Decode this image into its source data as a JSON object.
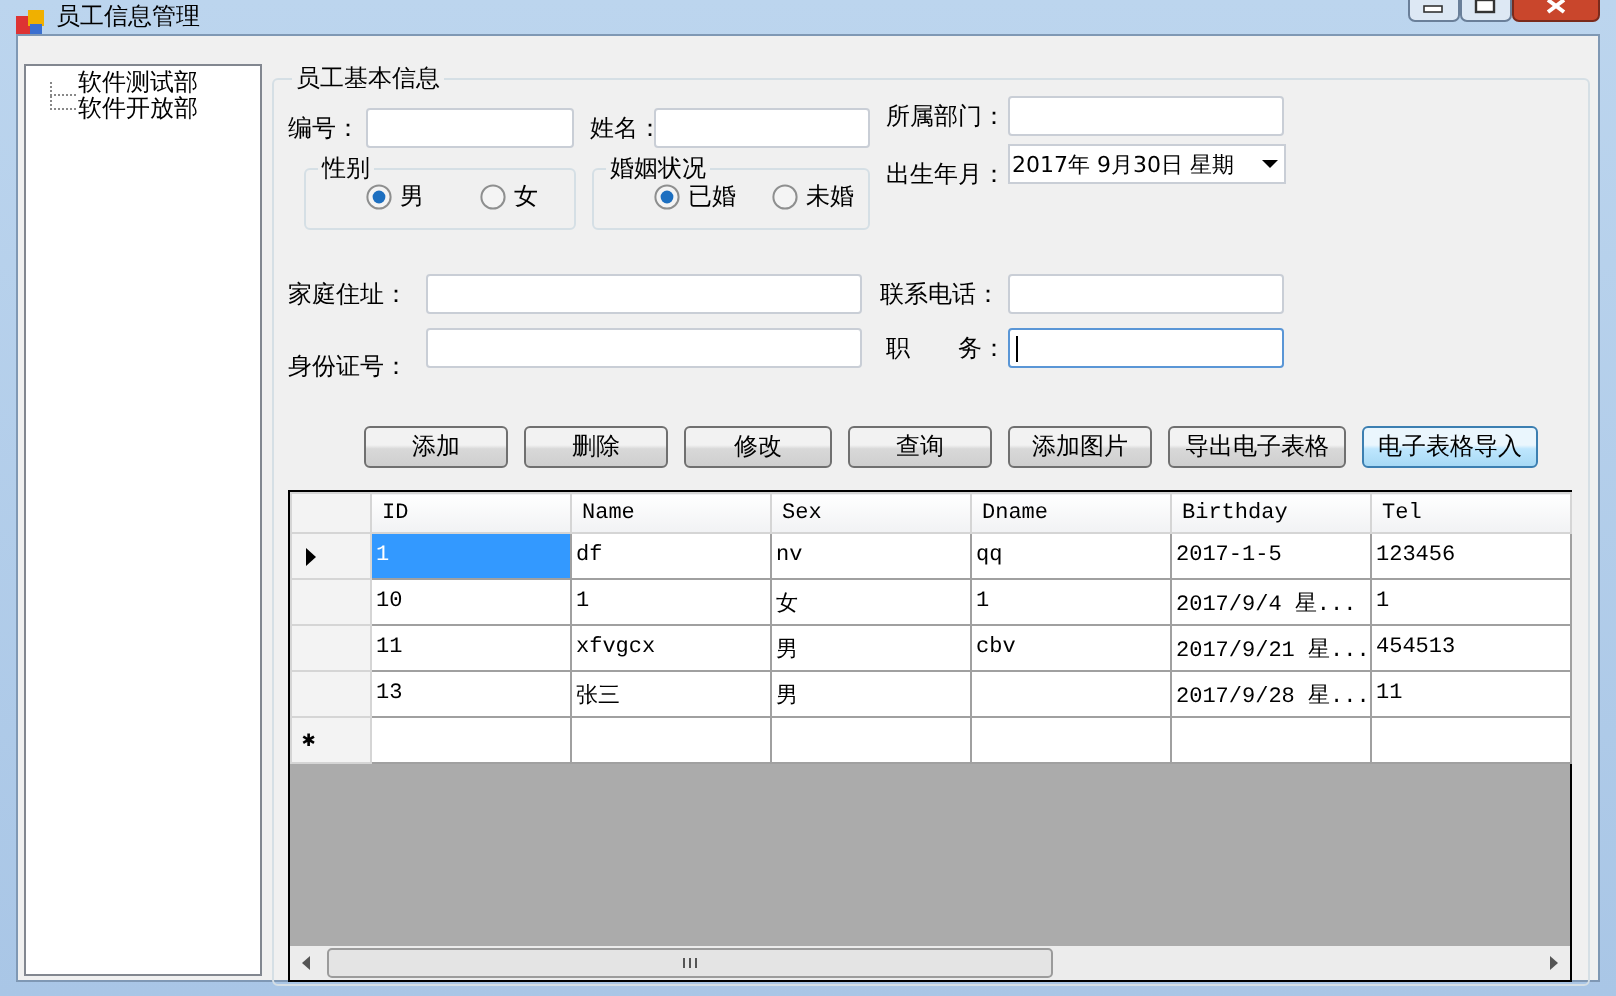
{
  "window": {
    "title": "员工信息管理"
  },
  "tree": {
    "items": [
      {
        "label": "软件测试部",
        "selected": false
      },
      {
        "label": "软件开放部",
        "selected": false
      }
    ]
  },
  "form": {
    "title": "员工基本信息",
    "fields": [
      {
        "label": "编号：",
        "focused": false
      },
      {
        "label": "姓名：",
        "focused": false
      },
      {
        "label": "所属部门：",
        "focused": false
      },
      {
        "label": "家庭住址：",
        "focused": false
      },
      {
        "label": "联系电话：",
        "focused": false
      },
      {
        "label": "身份证号：",
        "focused": false
      },
      {
        "label": "职　　务：",
        "focused": true
      }
    ],
    "radio_groups": [
      {
        "title": "性别",
        "options": [
          {
            "label": "男",
            "selected": true
          },
          {
            "label": "女",
            "selected": false
          }
        ]
      },
      {
        "title": "婚姻状况",
        "options": [
          {
            "label": "已婚",
            "selected": true
          },
          {
            "label": "未婚",
            "selected": false
          }
        ]
      }
    ],
    "date": {
      "label": "出生年月：",
      "value": "2017年 9月30日 星期"
    },
    "buttons": [
      {
        "label": "添加",
        "highlighted": false
      },
      {
        "label": "删除",
        "highlighted": false
      },
      {
        "label": "修改",
        "highlighted": false
      },
      {
        "label": "查询",
        "highlighted": false
      },
      {
        "label": "添加图片",
        "highlighted": false
      },
      {
        "label": "导出电子表格",
        "highlighted": false
      },
      {
        "label": "电子表格导入",
        "highlighted": true
      }
    ]
  },
  "table": {
    "columns": [
      "ID",
      "Name",
      "Sex",
      "Dname",
      "Birthday",
      "Tel"
    ],
    "rows": [
      {
        "current": true,
        "cells": [
          {
            "text": "1",
            "selected": true
          },
          {
            "text": "df",
            "selected": false
          },
          {
            "text": "nv",
            "selected": false
          },
          {
            "text": "qq",
            "selected": false
          },
          {
            "text": "2017-1-5",
            "selected": false
          },
          {
            "text": "123456",
            "selected": false
          }
        ]
      },
      {
        "current": false,
        "cells": [
          {
            "text": "10",
            "selected": false
          },
          {
            "text": "1",
            "selected": false
          },
          {
            "text": "女",
            "selected": false
          },
          {
            "text": "1",
            "selected": false
          },
          {
            "text": "2017/9/4 星...",
            "selected": false
          },
          {
            "text": "1",
            "selected": false
          }
        ]
      },
      {
        "current": false,
        "cells": [
          {
            "text": "11",
            "selected": false
          },
          {
            "text": "xfvgcx",
            "selected": false
          },
          {
            "text": "男",
            "selected": false
          },
          {
            "text": "cbv",
            "selected": false
          },
          {
            "text": "2017/9/21 星...",
            "selected": false
          },
          {
            "text": "454513",
            "selected": false
          }
        ]
      },
      {
        "current": false,
        "cells": [
          {
            "text": "13",
            "selected": false
          },
          {
            "text": "张三",
            "selected": false
          },
          {
            "text": "男",
            "selected": false
          },
          {
            "text": null,
            "selected": false
          },
          {
            "text": "2017/9/28 星...",
            "selected": false
          },
          {
            "text": "11",
            "selected": false
          }
        ]
      }
    ],
    "new_row_marker": "✱"
  }
}
